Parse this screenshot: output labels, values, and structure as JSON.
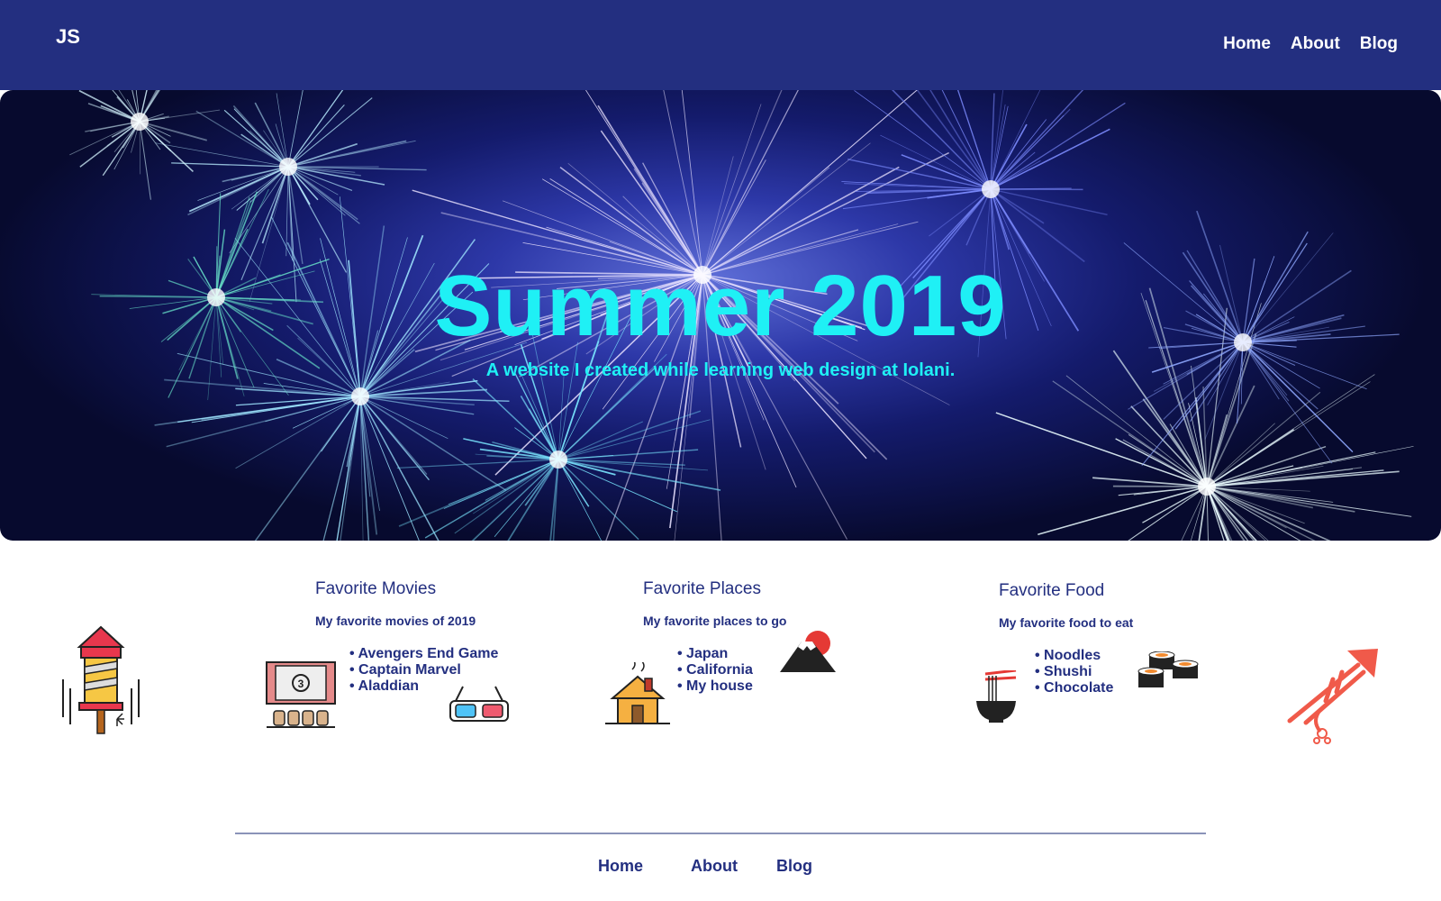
{
  "header": {
    "logo": "JS",
    "nav": [
      "Home",
      "About",
      "Blog"
    ]
  },
  "hero": {
    "title": "Summer 2019",
    "subtitle": "A website I created while learning web design at Iolani."
  },
  "sections": [
    {
      "title": "Favorite Movies",
      "subtitle": "My favorite movies of 2019",
      "items": [
        "Avengers End Game",
        "Captain Marvel",
        "Aladdian"
      ]
    },
    {
      "title": "Favorite Places",
      "subtitle": "My favorite places to go",
      "items": [
        "Japan",
        "California",
        "My house"
      ]
    },
    {
      "title": "Favorite Food",
      "subtitle": "My favorite food to eat",
      "items": [
        "Noodles",
        "Shushi",
        "Chocolate"
      ]
    }
  ],
  "footer": {
    "nav": [
      "Home",
      "About",
      "Blog"
    ]
  },
  "colors": {
    "header_bg": "#232f80",
    "hero_text": "#1ff0f5",
    "text": "#232f80"
  },
  "icons": [
    "firework-rocket-icon",
    "movie-theater-icon",
    "3d-glasses-icon",
    "house-icon",
    "mount-fuji-icon",
    "noodle-bowl-icon",
    "sushi-icon",
    "firework-launch-icon"
  ]
}
